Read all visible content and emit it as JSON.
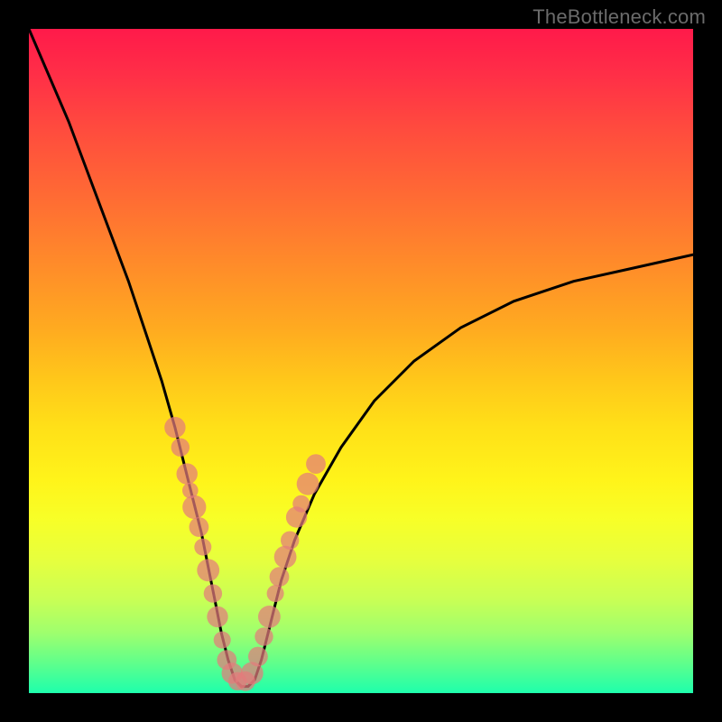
{
  "watermark": "TheBottleneck.com",
  "colors": {
    "frame": "#000000",
    "curve": "#000000",
    "marker": "#e37b7b",
    "gradient_top": "#ff1a4a",
    "gradient_bottom": "#1effac"
  },
  "chart_data": {
    "type": "line",
    "title": "",
    "xlabel": "",
    "ylabel": "",
    "xlim": [
      0,
      100
    ],
    "ylim": [
      0,
      100
    ],
    "note": "V-shaped bottleneck curve. y ≈ 100 at x=0, drops to y ≈ 0 near x ≈ 29–34, rises back toward y ≈ 66 at x=100. No axis ticks or numeric labels are shown; values are estimated from geometry.",
    "series": [
      {
        "name": "bottleneck-curve",
        "x": [
          0,
          3,
          6,
          9,
          12,
          15,
          18,
          20,
          22,
          24,
          25,
          26,
          27,
          28,
          29,
          30,
          31,
          32,
          33,
          34,
          35,
          36,
          37,
          38,
          40,
          43,
          47,
          52,
          58,
          65,
          73,
          82,
          91,
          100
        ],
        "y": [
          100,
          93,
          86,
          78,
          70,
          62,
          53,
          47,
          40,
          32,
          28,
          24,
          19,
          14,
          9,
          5,
          2,
          1,
          1,
          2,
          5,
          9,
          13,
          17,
          23,
          30,
          37,
          44,
          50,
          55,
          59,
          62,
          64,
          66
        ]
      }
    ],
    "markers": {
      "name": "highlighted-points",
      "description": "Salmon scatter points clustered along both arms of the V near the minimum, none at the exact bottom.",
      "points": [
        {
          "x": 22.0,
          "y": 40.0,
          "r": 1.6
        },
        {
          "x": 22.8,
          "y": 37.0,
          "r": 1.4
        },
        {
          "x": 23.8,
          "y": 33.0,
          "r": 1.6
        },
        {
          "x": 24.3,
          "y": 30.5,
          "r": 1.2
        },
        {
          "x": 24.9,
          "y": 28.0,
          "r": 1.8
        },
        {
          "x": 25.6,
          "y": 25.0,
          "r": 1.5
        },
        {
          "x": 26.2,
          "y": 22.0,
          "r": 1.3
        },
        {
          "x": 27.0,
          "y": 18.5,
          "r": 1.7
        },
        {
          "x": 27.7,
          "y": 15.0,
          "r": 1.4
        },
        {
          "x": 28.4,
          "y": 11.5,
          "r": 1.6
        },
        {
          "x": 29.1,
          "y": 8.0,
          "r": 1.3
        },
        {
          "x": 29.8,
          "y": 5.0,
          "r": 1.5
        },
        {
          "x": 30.6,
          "y": 3.0,
          "r": 1.6
        },
        {
          "x": 31.4,
          "y": 1.8,
          "r": 1.4
        },
        {
          "x": 32.6,
          "y": 1.8,
          "r": 1.5
        },
        {
          "x": 33.6,
          "y": 3.0,
          "r": 1.7
        },
        {
          "x": 34.5,
          "y": 5.5,
          "r": 1.5
        },
        {
          "x": 35.4,
          "y": 8.5,
          "r": 1.4
        },
        {
          "x": 36.2,
          "y": 11.5,
          "r": 1.7
        },
        {
          "x": 37.1,
          "y": 15.0,
          "r": 1.3
        },
        {
          "x": 37.7,
          "y": 17.5,
          "r": 1.5
        },
        {
          "x": 38.6,
          "y": 20.5,
          "r": 1.7
        },
        {
          "x": 39.3,
          "y": 23.0,
          "r": 1.4
        },
        {
          "x": 40.3,
          "y": 26.5,
          "r": 1.6
        },
        {
          "x": 41.0,
          "y": 28.5,
          "r": 1.3
        },
        {
          "x": 42.0,
          "y": 31.5,
          "r": 1.7
        },
        {
          "x": 43.2,
          "y": 34.5,
          "r": 1.5
        }
      ]
    }
  }
}
